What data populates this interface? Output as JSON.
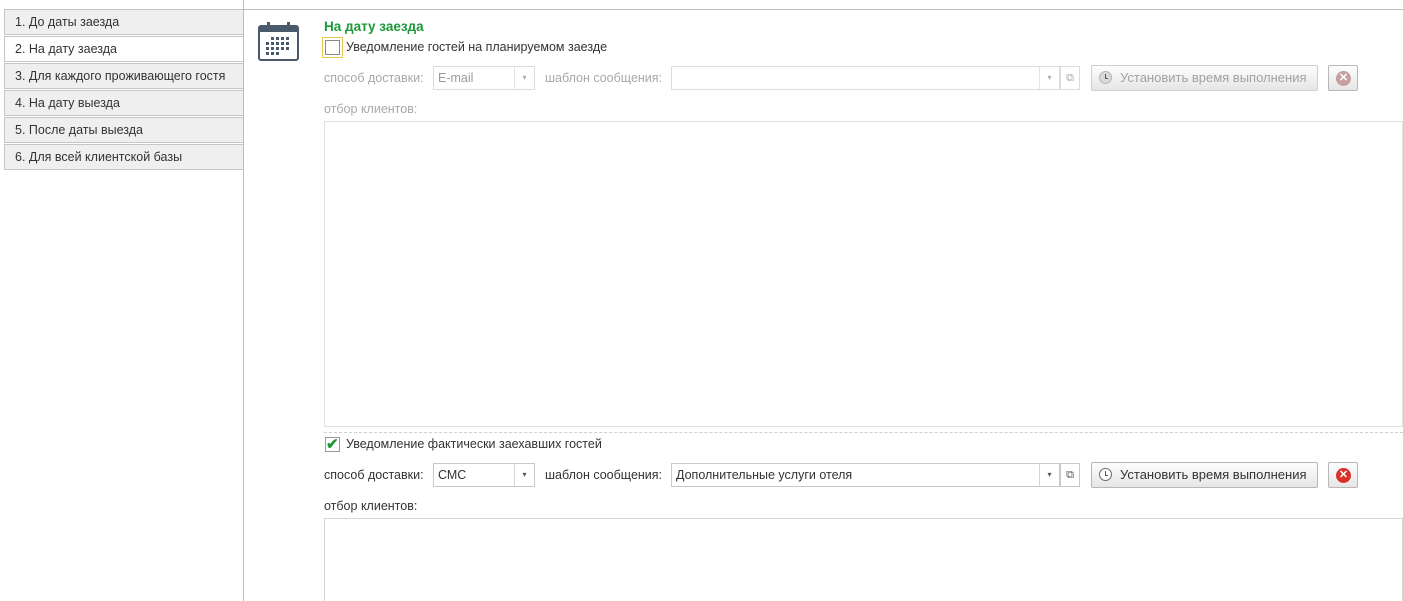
{
  "nav": {
    "items": [
      {
        "label": "1. До даты заезда",
        "active": false
      },
      {
        "label": "2. На дату заезда",
        "active": true
      },
      {
        "label": "3. Для каждого проживающего гостя",
        "active": false
      },
      {
        "label": "4. На дату выезда",
        "active": false
      },
      {
        "label": "5. После даты выезда",
        "active": false
      },
      {
        "label": "6. Для всей клиентской базы",
        "active": false
      }
    ]
  },
  "section": {
    "title": "На дату заезда",
    "icon": "calendar-icon",
    "title_color": "#1c9a3a"
  },
  "planned": {
    "checkbox_label": "Уведомление гостей на планируемом заезде",
    "checked": false,
    "delivery_label": "способ доставки:",
    "delivery_value": "E-mail",
    "template_label": "шаблон сообщения:",
    "template_value": "",
    "schedule_button": "Установить время выполнения",
    "filter_label": "отбор клиентов:"
  },
  "actual": {
    "checkbox_label": "Уведомление фактически заехавших гостей",
    "checked": true,
    "delivery_label": "способ доставки:",
    "delivery_value": "СМС",
    "template_label": "шаблон сообщения:",
    "template_value": "Дополнительные услуги отеля",
    "schedule_button": "Установить время выполнения",
    "filter_label": "отбор клиентов:"
  },
  "icons": {
    "dropdown": "▾",
    "open": "⧉",
    "checkmark": "✔",
    "delete": "✕"
  },
  "colors": {
    "accent_green": "#1c9a3a",
    "delete_red": "#d9302c"
  }
}
